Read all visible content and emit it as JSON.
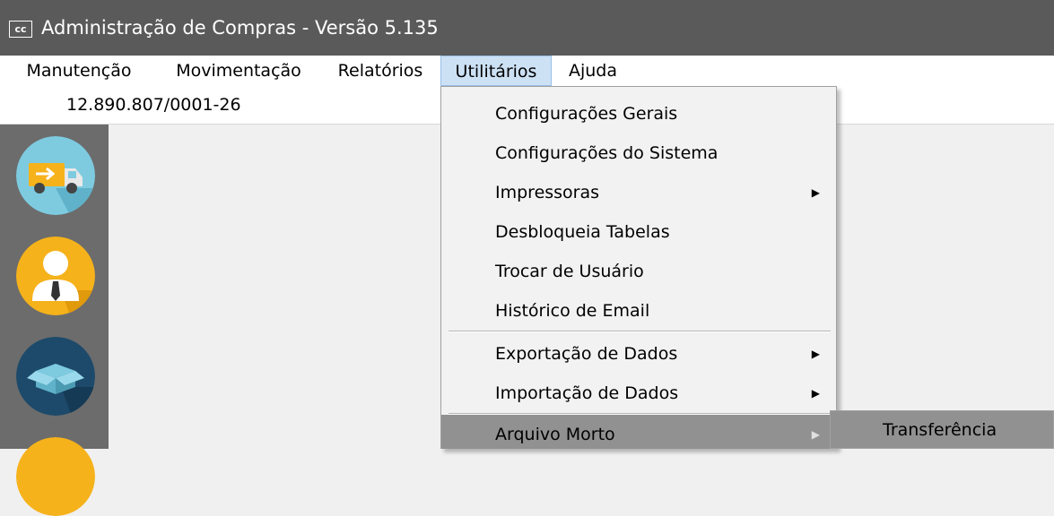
{
  "window": {
    "logo": "cc",
    "title": "Administração de Compras - Versão 5.135"
  },
  "menubar": {
    "items": [
      {
        "label": "Manutenção"
      },
      {
        "label": "Movimentação"
      },
      {
        "label": "Relatórios"
      },
      {
        "label": "Utilitários"
      },
      {
        "label": "Ajuda"
      }
    ],
    "active_color": "#cde1f5"
  },
  "company": {
    "cnpj": "12.890.807/0001-26"
  },
  "sidebar": {
    "icons": [
      {
        "name": "delivery-truck-icon",
        "color": "#7ecbe0"
      },
      {
        "name": "user-icon",
        "color": "#f5b21b"
      },
      {
        "name": "open-box-icon",
        "color": "#1d4a6a"
      },
      {
        "name": "partial-icon",
        "color": "#f5b21b"
      }
    ]
  },
  "dropdown": {
    "items": [
      {
        "label": "Configurações Gerais",
        "submenu": false
      },
      {
        "label": "Configurações do Sistema",
        "submenu": false
      },
      {
        "label": "Impressoras",
        "submenu": true
      },
      {
        "label": "Desbloqueia Tabelas",
        "submenu": false
      },
      {
        "label": "Trocar de Usuário",
        "submenu": false
      },
      {
        "label": "Histórico de Email",
        "submenu": false
      },
      {
        "label": "Exportação de Dados",
        "submenu": true
      },
      {
        "label": "Importação de Dados",
        "submenu": true
      },
      {
        "label": "Arquivo Morto",
        "submenu": true,
        "highlighted": true
      }
    ],
    "arrow_glyph": "▶",
    "highlight_color": "#919191"
  },
  "submenu": {
    "items": [
      {
        "label": "Transferência"
      }
    ]
  }
}
